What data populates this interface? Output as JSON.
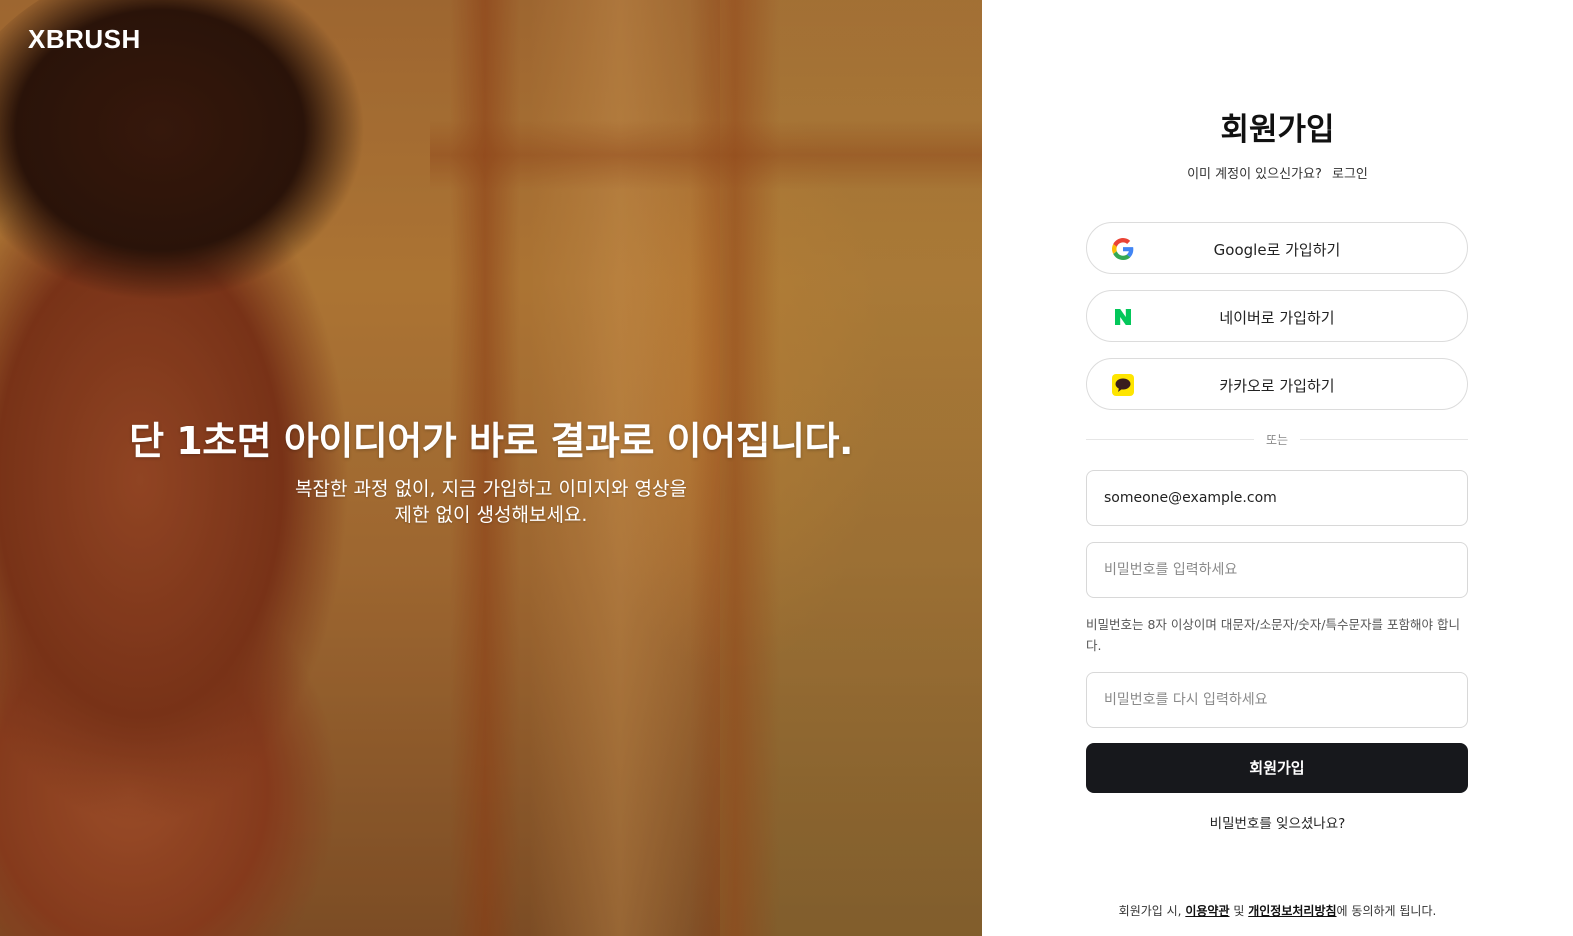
{
  "brand": {
    "logo": "XBRUSH"
  },
  "hero": {
    "title": "단 1초면 아이디어가 바로 결과로 이어집니다.",
    "subtitle_line1": "복잡한 과정 없이, 지금 가입하고 이미지와 영상을",
    "subtitle_line2": "제한 없이 생성해보세요."
  },
  "signup": {
    "title": "회원가입",
    "have_account": "이미 계정이 있으신가요?",
    "login_link": "로그인",
    "social": [
      {
        "label": "Google로 가입하기",
        "icon": "google-icon",
        "color": "#4285F4"
      },
      {
        "label": "네이버로 가입하기",
        "icon": "naver-icon",
        "color": "#03C75A"
      },
      {
        "label": "카카오로 가입하기",
        "icon": "kakao-icon",
        "color": "#FEE500"
      }
    ],
    "divider": "또는",
    "email": {
      "value": "someone@example.com",
      "placeholder": ""
    },
    "password": {
      "value": "",
      "placeholder": "비밀번호를 입력하세요"
    },
    "password_hint": "비밀번호는 8자 이상이며 대문자/소문자/숫자/특수문자를 포함해야 합니다.",
    "password_confirm": {
      "value": "",
      "placeholder": "비밀번호를 다시 입력하세요"
    },
    "submit": "회원가입",
    "forgot": "비밀번호를 잊으셨나요?",
    "terms": {
      "prefix": "회원가입 시,",
      "tos": "이용약관",
      "and": "및",
      "privacy": "개인정보처리방침",
      "suffix": "에 동의하게 됩니다."
    }
  },
  "colors": {
    "primary_button": "#17181c",
    "border": "#dcdcdc"
  }
}
